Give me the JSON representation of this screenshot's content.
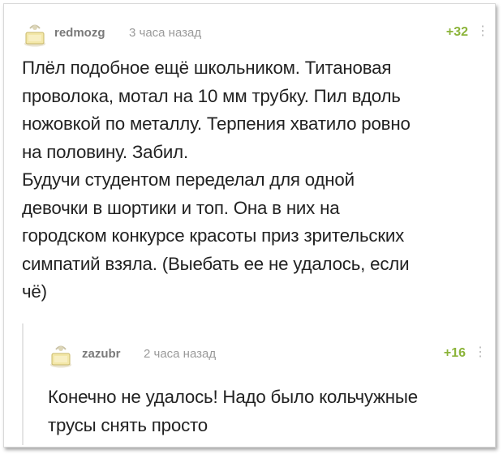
{
  "comment": {
    "username": "redmozg",
    "time": "3 часа назад",
    "score": "+32",
    "more_icon": "more-vertical-icon",
    "lines": [
      "Плёл подобное ещё школьником. Титановая",
      "проволока, мотал на 10 мм трубку.  Пил вдоль",
      "ножовкой по металлу. Терпения хватило ровно",
      "на половину. Забил.",
      "Будучи студентом переделал для одной",
      "девочки в шортики и топ. Она в них на",
      "городском конкурсе красоты приз зрительских",
      "симпатий взяла. (Выебать ее не удалось, если",
      "чё)"
    ]
  },
  "reply": {
    "username": "zazubr",
    "time": "2 часа назад",
    "score": "+16",
    "more_icon": "more-vertical-icon",
    "lines": [
      "Конечно не удалось! Надо было кольчужные",
      "трусы снять просто"
    ]
  },
  "colors": {
    "score": "#8cb43a",
    "username": "#7a7a7a",
    "time": "#9a9a9a",
    "text": "#222222"
  }
}
